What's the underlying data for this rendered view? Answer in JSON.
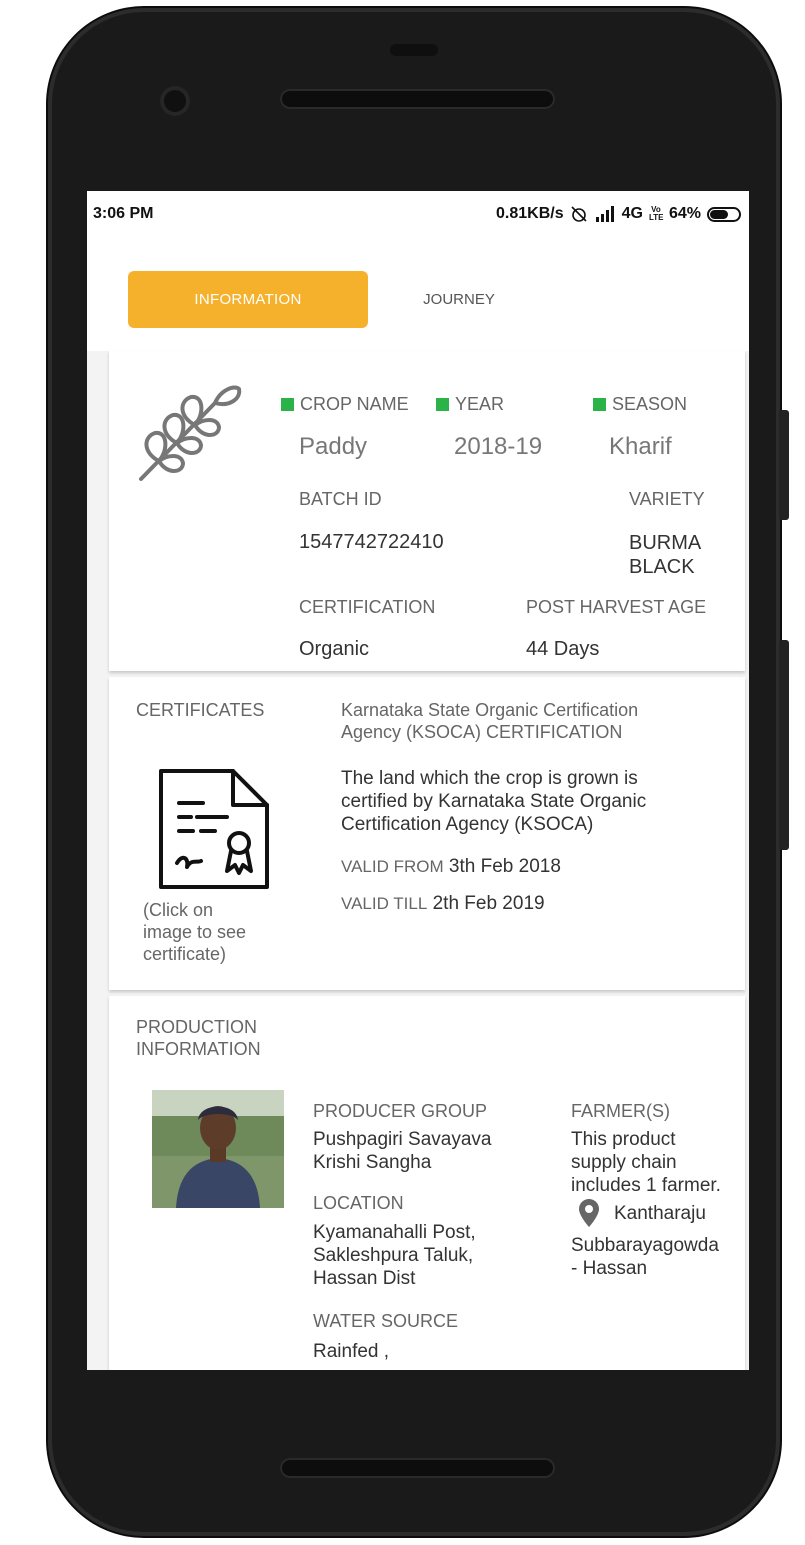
{
  "status_bar": {
    "time": "3:06 PM",
    "net_speed": "0.81KB/s",
    "network": "4G",
    "volte": "Vo LTE",
    "battery": "64%",
    "battery_level": 0.64
  },
  "tabs": {
    "information": "INFORMATION",
    "journey": "JOURNEY"
  },
  "crop": {
    "icon": "wheat-icon",
    "crop_name_label": "CROP NAME",
    "crop_name": "Paddy",
    "year_label": "YEAR",
    "year": "2018-19",
    "season_label": "SEASON",
    "season": "Kharif",
    "batch_id_label": "BATCH ID",
    "batch_id": "1547742722410",
    "variety_label": "VARIETY",
    "variety_line1": "BURMA",
    "variety_line2": "BLACK",
    "certification_label": "CERTIFICATION",
    "certification": "Organic",
    "post_harvest_label": "POST HARVEST AGE",
    "post_harvest": "44 Days",
    "indicator_color": "#2bb34a"
  },
  "certificates": {
    "label": "CERTIFICATES",
    "title_line1": "Karnataka State Organic Certification",
    "title_line2": "Agency (KSOCA) CERTIFICATION",
    "desc_line1": "The land which the crop is grown is",
    "desc_line2": "certified by Karnataka State Organic",
    "desc_line3": "Certification Agency (KSOCA)",
    "valid_from_label": "VALID FROM",
    "valid_from": "3th Feb 2018",
    "valid_till_label": "VALID TILL",
    "valid_till": "2th Feb 2019",
    "hint_line1": "(Click on",
    "hint_line2": "image to see",
    "hint_line3": "certificate)",
    "icon": "certificate-icon"
  },
  "production": {
    "label_line1": "PRODUCTION",
    "label_line2": "INFORMATION",
    "producer_group_label": "PRODUCER GROUP",
    "producer_group_line1": "Pushpagiri Savayava",
    "producer_group_line2": "Krishi Sangha",
    "location_label": "LOCATION",
    "location_line1": "Kyamanahalli Post,",
    "location_line2": "Sakleshpura Taluk,",
    "location_line3": "Hassan Dist",
    "water_source_label": "WATER SOURCE",
    "water_source": "Rainfed ,",
    "farmers_label": "FARMER(S)",
    "farmers_line1": "This product",
    "farmers_line2": "supply chain",
    "farmers_line3": "includes 1 farmer.",
    "farmer_name": "Kantharaju",
    "farmer_name_line2": "Subbarayagowda",
    "farmer_name_line3": "- Hassan",
    "pin_icon": "location-pin-icon"
  },
  "colors": {
    "accent": "#f6b12c",
    "green": "#2bb34a"
  }
}
